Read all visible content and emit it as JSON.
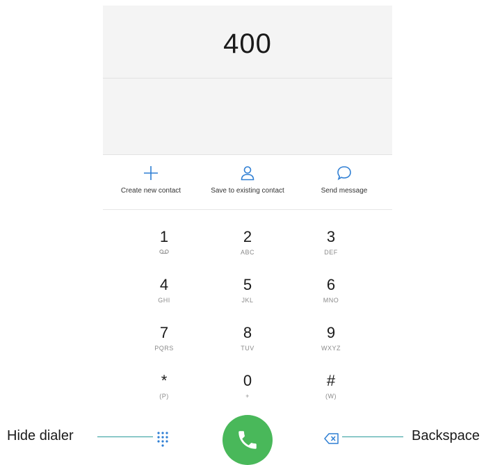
{
  "dialer": {
    "number": "400",
    "actions": [
      {
        "label": "Create new contact",
        "icon": "plus-icon"
      },
      {
        "label": "Save to existing contact",
        "icon": "person-icon"
      },
      {
        "label": "Send message",
        "icon": "message-bubble-icon"
      }
    ],
    "keys": [
      {
        "digit": "1",
        "letters": "QD"
      },
      {
        "digit": "2",
        "letters": "ABC"
      },
      {
        "digit": "3",
        "letters": "DEF"
      },
      {
        "digit": "4",
        "letters": "GHI"
      },
      {
        "digit": "5",
        "letters": "JKL"
      },
      {
        "digit": "6",
        "letters": "MNO"
      },
      {
        "digit": "7",
        "letters": "PQRS"
      },
      {
        "digit": "8",
        "letters": "TUV"
      },
      {
        "digit": "9",
        "letters": "WXYZ"
      },
      {
        "digit": "*",
        "letters": "(P)"
      },
      {
        "digit": "0",
        "letters": "+"
      },
      {
        "digit": "#",
        "letters": "(W)"
      }
    ],
    "call_icon": "phone-icon",
    "hide_icon": "dial-grid-icon",
    "backspace_icon": "backspace-icon"
  },
  "callouts": {
    "hide_dialer": "Hide dialer",
    "backspace": "Backspace"
  },
  "colors": {
    "accent": "#2f7fd4",
    "call_green": "#49b85a",
    "callout_line": "#2a9a9a",
    "panel_bg": "#f4f4f4"
  }
}
